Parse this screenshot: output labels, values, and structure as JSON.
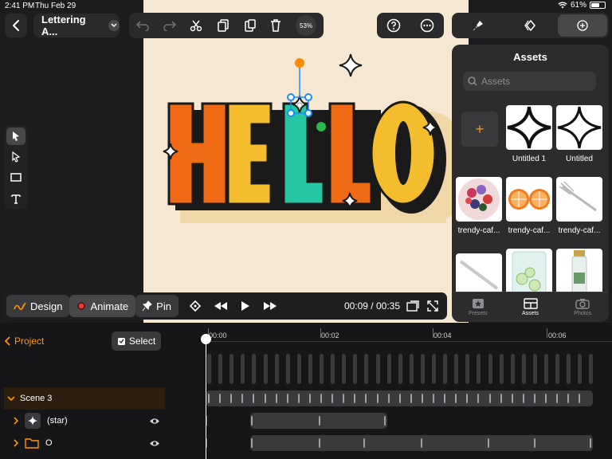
{
  "status_bar": {
    "time": "2:41 PM",
    "date": "Thu Feb 29",
    "battery": "61%",
    "battery_level": 0.61
  },
  "top_bar": {
    "document_title": "Lettering A...",
    "zoom_level": "53%"
  },
  "canvas": {
    "background_color": "#f6e7d2",
    "artwork_letters": [
      "H",
      "E",
      "L",
      "L",
      "O"
    ],
    "letter_colors": [
      "#f06a16",
      "#f3bd2d",
      "#27c6a3",
      "#f06a16",
      "#f3bd2d"
    ]
  },
  "assets_panel": {
    "title": "Assets",
    "search_placeholder": "Assets",
    "add_icon": "+",
    "items": [
      {
        "label": "Untitled 1"
      },
      {
        "label": "Untitled"
      },
      {
        "label": "trendy-caf..."
      },
      {
        "label": "trendy-caf..."
      },
      {
        "label": "trendy-caf..."
      }
    ],
    "tabs": [
      "Presets",
      "Assets",
      "Photos"
    ],
    "active_tab": "Assets"
  },
  "mode_bar": {
    "design_label": "Design",
    "animate_label": "Animate",
    "pin_label": "Pin",
    "time_display": "00:09 / 00:35"
  },
  "timeline": {
    "project_label": "Project",
    "select_label": "Select",
    "ruler_labels": [
      "00:00",
      "00:02",
      "00:04",
      "00:06"
    ],
    "scene_label": "Scene 3",
    "layers": [
      {
        "name": "(star)"
      },
      {
        "name": "O"
      }
    ]
  },
  "colors": {
    "accent": "#ff9500",
    "selection": "#1a8cff"
  }
}
